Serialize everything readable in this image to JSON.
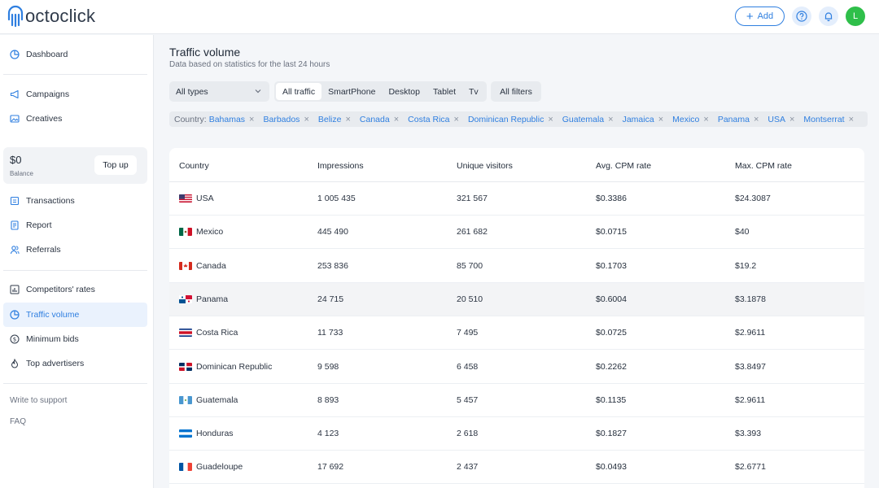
{
  "app": {
    "logo_text": "octoclick"
  },
  "header": {
    "add_label": "Add",
    "avatar_initial": "L"
  },
  "sidebar": {
    "items": [
      {
        "label": "Dashboard",
        "icon": "pie-chart-icon"
      },
      {
        "label": "Campaigns",
        "icon": "megaphone-icon"
      },
      {
        "label": "Creatives",
        "icon": "image-icon"
      },
      {
        "label": "Transactions",
        "icon": "wallet-icon"
      },
      {
        "label": "Report",
        "icon": "report-icon"
      },
      {
        "label": "Referrals",
        "icon": "users-icon"
      },
      {
        "label": "Competitors' rates",
        "icon": "bar-chart-icon"
      },
      {
        "label": "Traffic volume",
        "icon": "pie-chart-icon"
      },
      {
        "label": "Minimum bids",
        "icon": "dollar-icon"
      },
      {
        "label": "Top advertisers",
        "icon": "flame-icon"
      }
    ],
    "balance": {
      "amount": "$0",
      "label": "Balance",
      "topup_label": "Top up"
    },
    "support_label": "Write to support",
    "faq_label": "FAQ"
  },
  "page": {
    "title": "Traffic volume",
    "subtitle": "Data based on statistics for the last 24 hours"
  },
  "filters": {
    "types_label": "All types",
    "segments": [
      "All traffic",
      "SmartPhone",
      "Desktop",
      "Tablet",
      "Tv"
    ],
    "active_segment": "All traffic",
    "all_filters_label": "All filters",
    "country_label": "Country:",
    "countries": [
      "Bahamas",
      "Barbados",
      "Belize",
      "Canada",
      "Costa Rica",
      "Dominican Republic",
      "Guatemala",
      "Jamaica",
      "Mexico",
      "Panama",
      "USA",
      "Montserrat"
    ]
  },
  "table": {
    "headers": [
      "Country",
      "Impressions",
      "Unique visitors",
      "Avg. CPM rate",
      "Max. CPM rate"
    ],
    "rows": [
      {
        "country": "USA",
        "flag": "usa",
        "impressions": "1 005 435",
        "unique": "321 567",
        "avg": "$0.3386",
        "max": "$24.3087"
      },
      {
        "country": "Mexico",
        "flag": "mexico",
        "impressions": "445 490",
        "unique": "261 682",
        "avg": "$0.0715",
        "max": "$40"
      },
      {
        "country": "Canada",
        "flag": "canada",
        "impressions": "253 836",
        "unique": "85 700",
        "avg": "$0.1703",
        "max": "$19.2"
      },
      {
        "country": "Panama",
        "flag": "panama",
        "impressions": "24 715",
        "unique": "20 510",
        "avg": "$0.6004",
        "max": "$3.1878"
      },
      {
        "country": "Costa Rica",
        "flag": "costa-rica",
        "impressions": "11 733",
        "unique": "7 495",
        "avg": "$0.0725",
        "max": "$2.9611"
      },
      {
        "country": "Dominican Republic",
        "flag": "dominican-republic",
        "impressions": "9 598",
        "unique": "6 458",
        "avg": "$0.2262",
        "max": "$3.8497"
      },
      {
        "country": "Guatemala",
        "flag": "guatemala",
        "impressions": "8 893",
        "unique": "5 457",
        "avg": "$0.1135",
        "max": "$2.9611"
      },
      {
        "country": "Honduras",
        "flag": "honduras",
        "impressions": "4 123",
        "unique": "2 618",
        "avg": "$0.1827",
        "max": "$3.393"
      },
      {
        "country": "Guadeloupe",
        "flag": "guadeloupe",
        "impressions": "17 692",
        "unique": "2 437",
        "avg": "$0.0493",
        "max": "$2.6771"
      }
    ]
  },
  "colors": {
    "accent": "#2f7fe0",
    "avatar": "#2fbf4a",
    "active_bg": "#eaf2fd"
  }
}
